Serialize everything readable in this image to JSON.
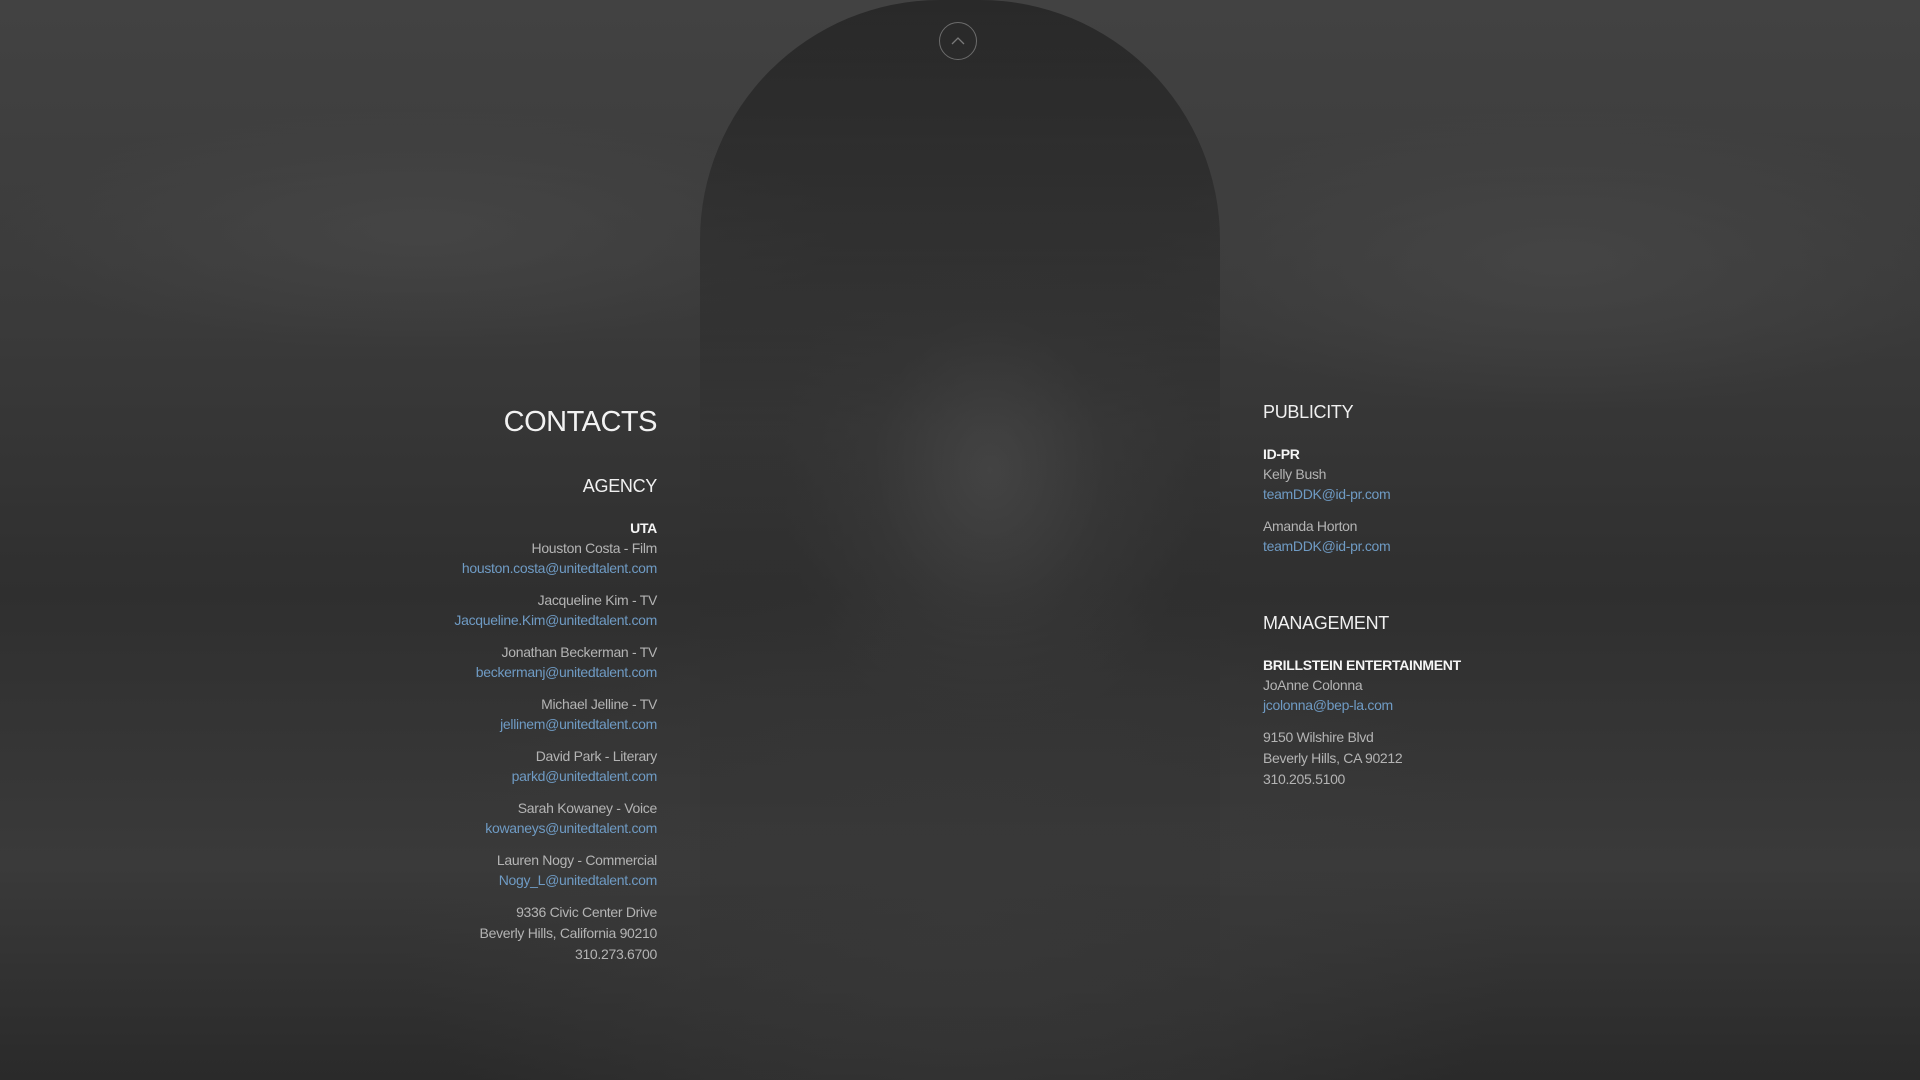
{
  "page_title": "CONTACTS",
  "agency": {
    "title": "AGENCY",
    "company": "UTA",
    "contacts": [
      {
        "name": "Houston Costa - Film",
        "email": "houston.costa@unitedtalent.com"
      },
      {
        "name": "Jacqueline Kim - TV",
        "email": "Jacqueline.Kim@unitedtalent.com"
      },
      {
        "name": "Jonathan Beckerman - TV",
        "email": "beckermanj@unitedtalent.com"
      },
      {
        "name": "Michael Jelline - TV",
        "email": "jellinem@unitedtalent.com"
      },
      {
        "name": "David Park - Literary",
        "email": "parkd@unitedtalent.com"
      },
      {
        "name": "Sarah Kowaney - Voice",
        "email": "kowaneys@unitedtalent.com"
      },
      {
        "name": "Lauren Nogy - Commercial",
        "email": "Nogy_L@unitedtalent.com"
      }
    ],
    "address": [
      "9336 Civic Center Drive",
      "Beverly Hills, California 90210",
      "310.273.6700"
    ]
  },
  "publicity": {
    "title": "PUBLICITY",
    "company": "ID-PR",
    "contacts": [
      {
        "name": "Kelly Bush",
        "email": "teamDDK@id-pr.com"
      },
      {
        "name": "Amanda Horton",
        "email": "teamDDK@id-pr.com"
      }
    ]
  },
  "management": {
    "title": "MANAGEMENT",
    "company": "BRILLSTEIN ENTERTAINMENT",
    "contacts": [
      {
        "name": "JoAnne Colonna",
        "email": "jcolonna@bep-la.com"
      }
    ],
    "address": [
      "9150 Wilshire Blvd",
      "Beverly Hills, CA 90212",
      "310.205.5100"
    ]
  },
  "icons": {
    "scroll_up": "chevron-up-icon"
  },
  "colors": {
    "link": "#6f9bc4",
    "text_muted": "#b4b4b4",
    "heading": "#f2f2f2"
  }
}
